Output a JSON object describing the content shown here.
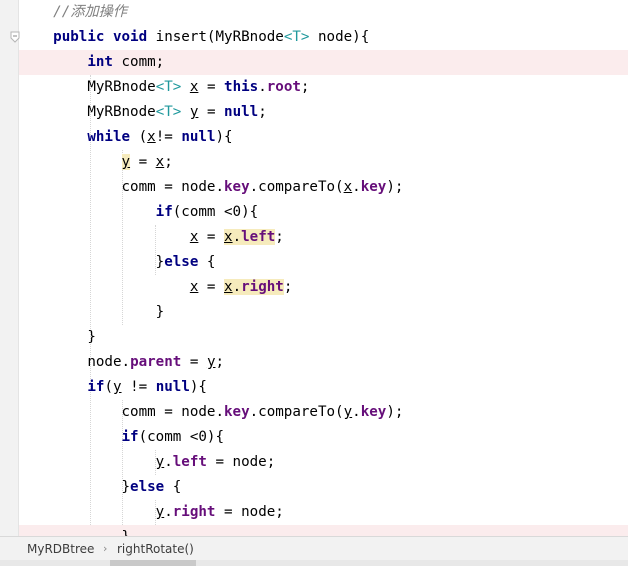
{
  "code": {
    "comment": "//添加操作",
    "kw_public": "public",
    "kw_void": "void",
    "method_name": " insert(",
    "param_type": "MyRBnode",
    "generic_T": "<T>",
    "param_rest": " node){",
    "kw_int": "int",
    "comm_decl": " comm;",
    "type_myrbnode": "MyRBnode",
    "var_x": "x",
    "var_y": "y",
    "eq": " = ",
    "kw_this": "this",
    "dot": ".",
    "field_root": "root",
    "semi": ";",
    "kw_null": "null",
    "kw_while": "while",
    "while_cond_open": " (",
    "while_cond_mid": "!= ",
    "while_cond_close": "){",
    "y_eq_x_mid": " = ",
    "comm_assign": "comm = node.",
    "field_key": "key",
    "compare_to": ".compareTo(",
    "close_paren_semi": ");",
    "kw_if": "if",
    "if_comm_cond": "(comm <0){",
    "field_left": "left",
    "field_right": "right",
    "close_brace": "}",
    "else_open": " {",
    "kw_else": "else",
    "node_dot": "node.",
    "field_parent": "parent",
    "if_y_open": "(",
    "if_y_mid": " != ",
    "if_y_close": "){",
    "assign_node": " = node;"
  },
  "breadcrumb": {
    "class_name": "MyRDBtree",
    "separator": "›",
    "method_name": "rightRotate()"
  }
}
